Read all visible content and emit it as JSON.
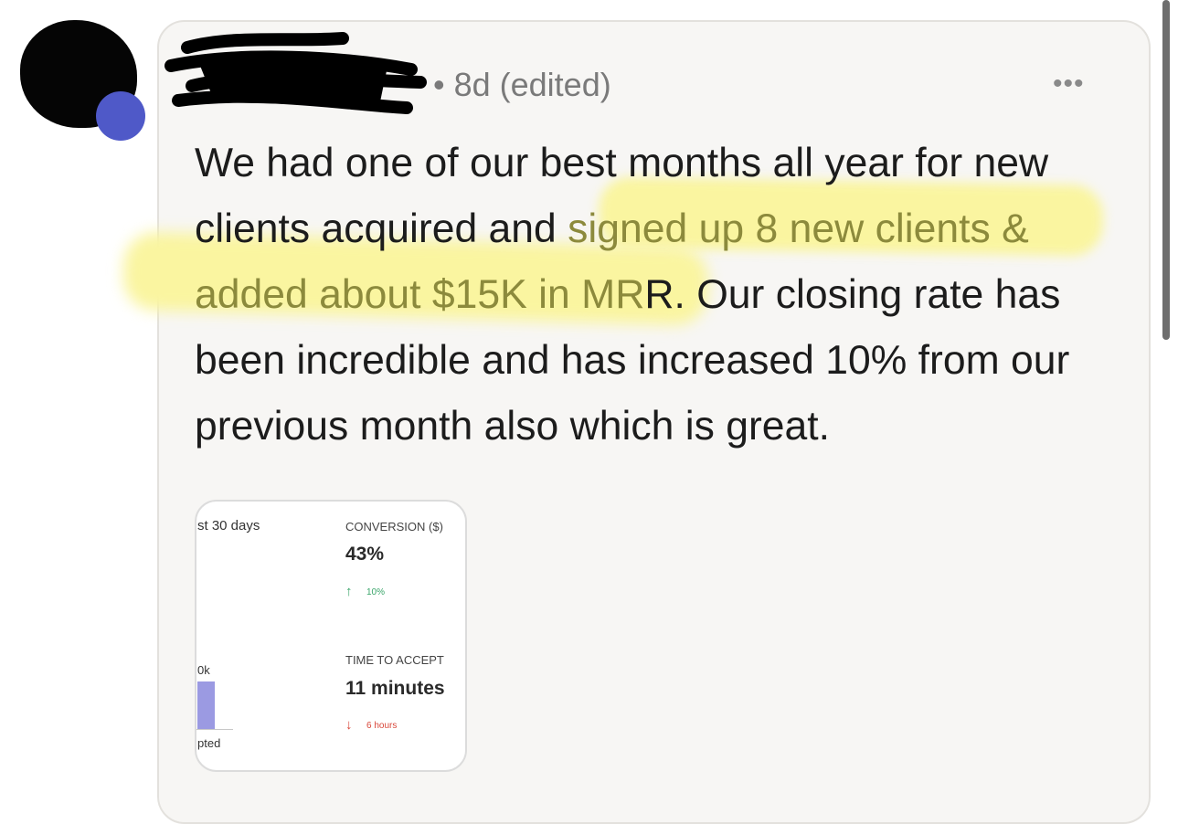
{
  "post": {
    "meta": "• 8d (edited)",
    "more_label": "•••",
    "text_before": "We had one of our best months all year for new clients acquired and ",
    "text_highlight_1": "signed up 8 new clients & added about $15K in MR",
    "text_highlight_2": "R",
    "text_after": ". Our closing rate has been incredible and has increased 10% from our previous month also which is great."
  },
  "thumbnail": {
    "period_label": "st 30 days",
    "bar_tick_label": "0k",
    "bar_caption": "pted",
    "metrics": [
      {
        "label": "CONVERSION ($)",
        "value": "43%",
        "change_arrow": "↑",
        "change": "10%"
      },
      {
        "label": "TIME TO ACCEPT",
        "value": "11 minutes",
        "change_arrow": "↓",
        "change": "6 hours"
      }
    ]
  },
  "colors": {
    "highlight": "#faf5a0",
    "highlight_text": "#8c8a3c",
    "avatar_badge": "#4f59c8",
    "bar": "#9b9ae2",
    "positive": "#3aa56a",
    "negative": "#d9483b"
  }
}
